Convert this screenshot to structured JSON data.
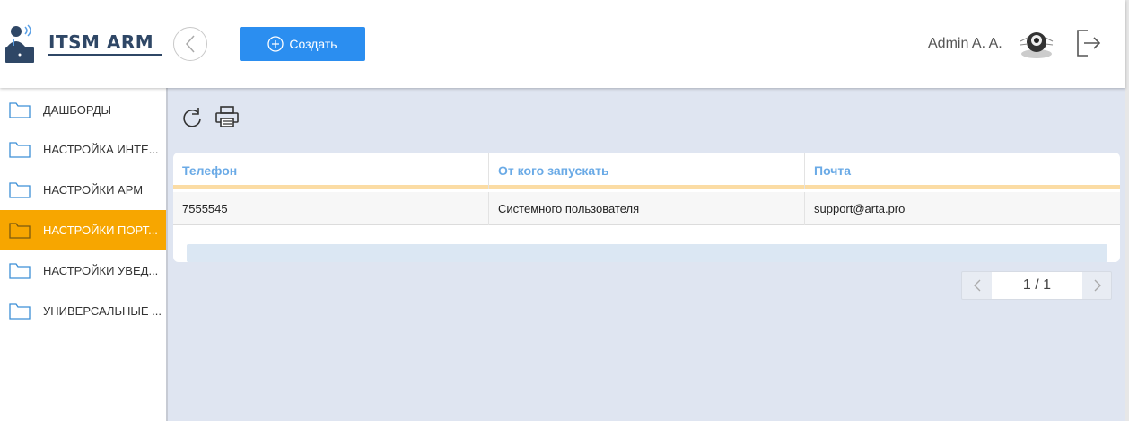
{
  "header": {
    "logo_text": "ITSM ARM",
    "create_label": "Создать",
    "user_name": "Admin A. A.",
    "icons": {
      "back": "chevron-left-icon",
      "create": "plus-circle-icon",
      "logout": "logout-icon"
    }
  },
  "sidebar": {
    "items": [
      {
        "label": "ДАШБОРДЫ",
        "active": false
      },
      {
        "label": "НАСТРОЙКА ИНТЕ...",
        "active": false
      },
      {
        "label": "НАСТРОЙКИ АРМ",
        "active": false
      },
      {
        "label": "НАСТРОЙКИ ПОРТ...",
        "active": true
      },
      {
        "label": "НАСТРОЙКИ УВЕД...",
        "active": false
      },
      {
        "label": "УНИВЕРСАЛЬНЫЕ ...",
        "active": false
      }
    ]
  },
  "toolbar": {
    "icons": [
      "refresh-icon",
      "print-icon"
    ]
  },
  "table": {
    "columns": [
      "Телефон",
      "От кого запускать",
      "Почта"
    ],
    "rows": [
      [
        "7555545",
        "Системного пользователя",
        "support@arta.pro"
      ]
    ]
  },
  "pagination": {
    "page": "1 / 1"
  },
  "colors": {
    "accent": "#2b8ef0",
    "active_item": "#f7a600",
    "header_text": "#6aaae6",
    "background": "#dfe5f1",
    "logo": "#2f4766"
  }
}
